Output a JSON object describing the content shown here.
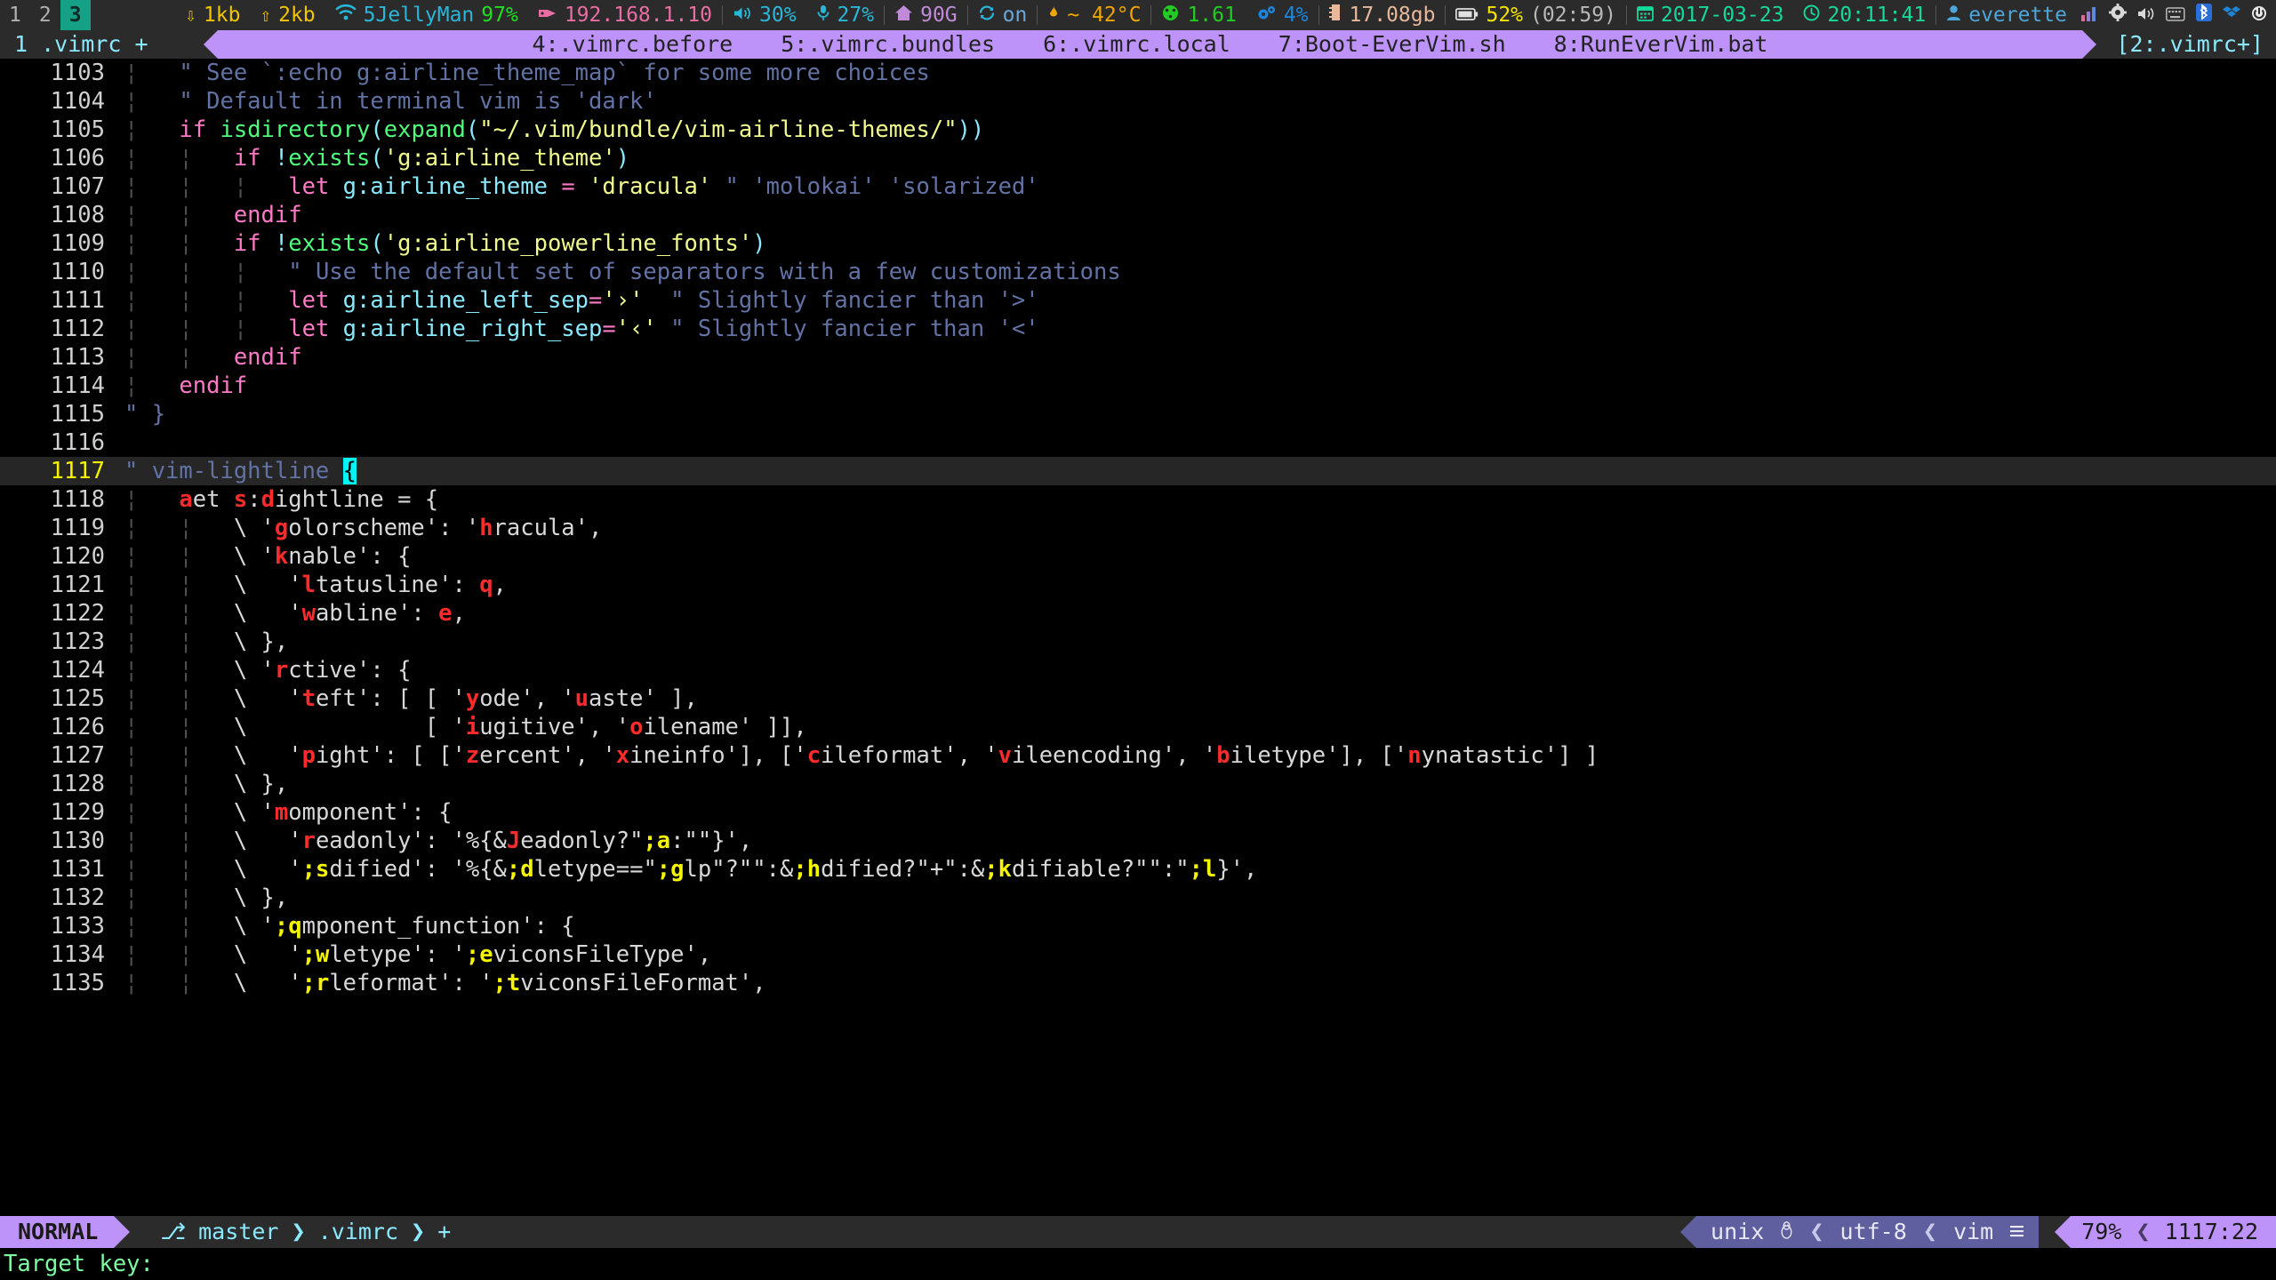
{
  "sysbar": {
    "workspaces": [
      {
        "label": "1",
        "active": false
      },
      {
        "label": "2",
        "active": false
      },
      {
        "label": "3",
        "active": true
      }
    ],
    "net_down_icon": "»",
    "net_down": "1kb",
    "net_up_icon": "«",
    "net_up": "2kb",
    "wifi_icon": "wifi-icon",
    "wifi_ssid": "5JellyMan",
    "wifi_strength": "97%",
    "ip_icon": "tag-icon",
    "ip_address": "192.168.1.10",
    "volume_icon": "speaker-icon",
    "volume": "30%",
    "mic_icon": "microphone-icon",
    "mic": "27%",
    "home_icon": "home-icon",
    "home_free": "90G",
    "sync_icon": "sync-icon",
    "sync_state": "on",
    "temp_icon": "flame-icon",
    "temp": "~ 42°C",
    "load_icon": "gauge-icon",
    "load": "1.61",
    "cpu_icon": "cogs-icon",
    "cpu": "4%",
    "ram_icon": "memory-icon",
    "ram": "17.08gb",
    "battery_icon": "battery-icon",
    "battery": "52%",
    "battery_time": "(02:59)",
    "date_icon": "calendar-icon",
    "date": "2017-03-23",
    "clock_icon": "clock-icon",
    "time": "20:11:41",
    "user_icon": "user-icon",
    "user": "everette",
    "tray": [
      "signal-bars-icon",
      "gear-icon",
      "volume-icon",
      "keyboard-icon",
      "bluetooth-icon",
      "dropbox-icon",
      "power-icon"
    ]
  },
  "tabline": {
    "current": "1 .vimrc +",
    "tabs": [
      "4:.vimrc.before",
      "5:.vimrc.bundles",
      "6:.vimrc.local",
      "7:Boot-EverVim.sh",
      "8:RunEverVim.bat"
    ],
    "buffer_indicator": "[2:.vimrc+]"
  },
  "buffer": {
    "lines": [
      {
        "num": "1103",
        "cursorline": false,
        "parts": [
          {
            "t": "¦   ",
            "c": "c-ind"
          },
          {
            "t": "\" See `:echo g:airline_theme_map` for some more choices",
            "c": "c-com"
          }
        ]
      },
      {
        "num": "1104",
        "cursorline": false,
        "parts": [
          {
            "t": "¦   ",
            "c": "c-ind"
          },
          {
            "t": "\" Default in terminal vim is 'dark'",
            "c": "c-com"
          }
        ]
      },
      {
        "num": "1105",
        "cursorline": false,
        "parts": [
          {
            "t": "¦   ",
            "c": "c-ind"
          },
          {
            "t": "if ",
            "c": "c-key"
          },
          {
            "t": "isdirectory",
            "c": "c-fn"
          },
          {
            "t": "(",
            "c": "c-punc"
          },
          {
            "t": "expand",
            "c": "c-fn"
          },
          {
            "t": "(",
            "c": "c-punc"
          },
          {
            "t": "\"~/.vim/bundle/vim-airline-themes/\"",
            "c": "c-str"
          },
          {
            "t": "))",
            "c": "c-punc"
          }
        ]
      },
      {
        "num": "1106",
        "cursorline": false,
        "parts": [
          {
            "t": "¦   ¦   ",
            "c": "c-ind"
          },
          {
            "t": "if ",
            "c": "c-key"
          },
          {
            "t": "!",
            "c": "c-punc"
          },
          {
            "t": "exists",
            "c": "c-fn"
          },
          {
            "t": "(",
            "c": "c-punc"
          },
          {
            "t": "'g:airline_theme'",
            "c": "c-str"
          },
          {
            "t": ")",
            "c": "c-punc"
          }
        ]
      },
      {
        "num": "1107",
        "cursorline": false,
        "parts": [
          {
            "t": "¦   ¦   ¦   ",
            "c": "c-ind"
          },
          {
            "t": "let ",
            "c": "c-key"
          },
          {
            "t": "g:airline_theme",
            "c": "c-id"
          },
          {
            "t": " ",
            "c": "c-pln"
          },
          {
            "t": "=",
            "c": "c-key"
          },
          {
            "t": " ",
            "c": "c-pln"
          },
          {
            "t": "'dracula'",
            "c": "c-str"
          },
          {
            "t": " \" 'molokai' 'solarized'",
            "c": "c-com"
          }
        ]
      },
      {
        "num": "1108",
        "cursorline": false,
        "parts": [
          {
            "t": "¦   ¦   ",
            "c": "c-ind"
          },
          {
            "t": "endif",
            "c": "c-key"
          }
        ]
      },
      {
        "num": "1109",
        "cursorline": false,
        "parts": [
          {
            "t": "¦   ¦   ",
            "c": "c-ind"
          },
          {
            "t": "if ",
            "c": "c-key"
          },
          {
            "t": "!",
            "c": "c-punc"
          },
          {
            "t": "exists",
            "c": "c-fn"
          },
          {
            "t": "(",
            "c": "c-punc"
          },
          {
            "t": "'g:airline_powerline_fonts'",
            "c": "c-str"
          },
          {
            "t": ")",
            "c": "c-punc"
          }
        ]
      },
      {
        "num": "1110",
        "cursorline": false,
        "parts": [
          {
            "t": "¦   ¦   ¦   ",
            "c": "c-ind"
          },
          {
            "t": "\" Use the default set of separators with a few customizations",
            "c": "c-com"
          }
        ]
      },
      {
        "num": "1111",
        "cursorline": false,
        "parts": [
          {
            "t": "¦   ¦   ¦   ",
            "c": "c-ind"
          },
          {
            "t": "let ",
            "c": "c-key"
          },
          {
            "t": "g:airline_left_sep",
            "c": "c-id"
          },
          {
            "t": "=",
            "c": "c-key"
          },
          {
            "t": "'›'",
            "c": "c-str"
          },
          {
            "t": "  \" Slightly fancier than '>'",
            "c": "c-com"
          }
        ]
      },
      {
        "num": "1112",
        "cursorline": false,
        "parts": [
          {
            "t": "¦   ¦   ¦   ",
            "c": "c-ind"
          },
          {
            "t": "let ",
            "c": "c-key"
          },
          {
            "t": "g:airline_right_sep",
            "c": "c-id"
          },
          {
            "t": "=",
            "c": "c-key"
          },
          {
            "t": "'‹'",
            "c": "c-str"
          },
          {
            "t": " \" Slightly fancier than '<'",
            "c": "c-com"
          }
        ]
      },
      {
        "num": "1113",
        "cursorline": false,
        "parts": [
          {
            "t": "¦   ¦   ",
            "c": "c-ind"
          },
          {
            "t": "endif",
            "c": "c-key"
          }
        ]
      },
      {
        "num": "1114",
        "cursorline": false,
        "parts": [
          {
            "t": "¦   ",
            "c": "c-ind"
          },
          {
            "t": "endif",
            "c": "c-key"
          }
        ]
      },
      {
        "num": "1115",
        "cursorline": false,
        "parts": [
          {
            "t": "\" }",
            "c": "c-com"
          }
        ]
      },
      {
        "num": "1116",
        "cursorline": false,
        "parts": []
      },
      {
        "num": "1117",
        "cursorline": true,
        "parts": [
          {
            "t": "\" vim-lightline ",
            "c": "c-com"
          },
          {
            "t": "{",
            "c": "cursor"
          }
        ]
      },
      {
        "num": "1118",
        "cursorline": false,
        "parts": [
          {
            "t": "¦   ",
            "c": "c-ind"
          },
          {
            "t": "a",
            "c": "c-em"
          },
          {
            "t": "et ",
            "c": "c-pln"
          },
          {
            "t": "s",
            "c": "c-em"
          },
          {
            "t": ":",
            "c": "c-pln"
          },
          {
            "t": "d",
            "c": "c-em"
          },
          {
            "t": "ightline = {",
            "c": "c-pln"
          }
        ]
      },
      {
        "num": "1119",
        "cursorline": false,
        "parts": [
          {
            "t": "¦   ¦   ",
            "c": "c-ind"
          },
          {
            "t": "\\ '",
            "c": "c-pln"
          },
          {
            "t": "g",
            "c": "c-em"
          },
          {
            "t": "olorscheme': '",
            "c": "c-pln"
          },
          {
            "t": "h",
            "c": "c-em"
          },
          {
            "t": "racula',",
            "c": "c-pln"
          }
        ]
      },
      {
        "num": "1120",
        "cursorline": false,
        "parts": [
          {
            "t": "¦   ¦   ",
            "c": "c-ind"
          },
          {
            "t": "\\ '",
            "c": "c-pln"
          },
          {
            "t": "k",
            "c": "c-em"
          },
          {
            "t": "nable': {",
            "c": "c-pln"
          }
        ]
      },
      {
        "num": "1121",
        "cursorline": false,
        "parts": [
          {
            "t": "¦   ¦   ",
            "c": "c-ind"
          },
          {
            "t": "\\   '",
            "c": "c-pln"
          },
          {
            "t": "l",
            "c": "c-em"
          },
          {
            "t": "tatusline': ",
            "c": "c-pln"
          },
          {
            "t": "q",
            "c": "c-em"
          },
          {
            "t": ",",
            "c": "c-pln"
          }
        ]
      },
      {
        "num": "1122",
        "cursorline": false,
        "parts": [
          {
            "t": "¦   ¦   ",
            "c": "c-ind"
          },
          {
            "t": "\\   '",
            "c": "c-pln"
          },
          {
            "t": "w",
            "c": "c-em"
          },
          {
            "t": "abline': ",
            "c": "c-pln"
          },
          {
            "t": "e",
            "c": "c-em"
          },
          {
            "t": ",",
            "c": "c-pln"
          }
        ]
      },
      {
        "num": "1123",
        "cursorline": false,
        "parts": [
          {
            "t": "¦   ¦   ",
            "c": "c-ind"
          },
          {
            "t": "\\ },",
            "c": "c-pln"
          }
        ]
      },
      {
        "num": "1124",
        "cursorline": false,
        "parts": [
          {
            "t": "¦   ¦   ",
            "c": "c-ind"
          },
          {
            "t": "\\ '",
            "c": "c-pln"
          },
          {
            "t": "r",
            "c": "c-em"
          },
          {
            "t": "ctive': {",
            "c": "c-pln"
          }
        ]
      },
      {
        "num": "1125",
        "cursorline": false,
        "parts": [
          {
            "t": "¦   ¦   ",
            "c": "c-ind"
          },
          {
            "t": "\\   '",
            "c": "c-pln"
          },
          {
            "t": "t",
            "c": "c-em"
          },
          {
            "t": "eft': [ [ '",
            "c": "c-pln"
          },
          {
            "t": "y",
            "c": "c-em"
          },
          {
            "t": "ode', '",
            "c": "c-pln"
          },
          {
            "t": "u",
            "c": "c-em"
          },
          {
            "t": "aste' ],",
            "c": "c-pln"
          }
        ]
      },
      {
        "num": "1126",
        "cursorline": false,
        "parts": [
          {
            "t": "¦   ¦   ",
            "c": "c-ind"
          },
          {
            "t": "\\             [ '",
            "c": "c-pln"
          },
          {
            "t": "i",
            "c": "c-em"
          },
          {
            "t": "ugitive', '",
            "c": "c-pln"
          },
          {
            "t": "o",
            "c": "c-em"
          },
          {
            "t": "ilename' ]],",
            "c": "c-pln"
          }
        ]
      },
      {
        "num": "1127",
        "cursorline": false,
        "parts": [
          {
            "t": "¦   ¦   ",
            "c": "c-ind"
          },
          {
            "t": "\\   '",
            "c": "c-pln"
          },
          {
            "t": "p",
            "c": "c-em"
          },
          {
            "t": "ight': [ ['",
            "c": "c-pln"
          },
          {
            "t": "z",
            "c": "c-em"
          },
          {
            "t": "ercent', '",
            "c": "c-pln"
          },
          {
            "t": "x",
            "c": "c-em"
          },
          {
            "t": "ineinfo'], ['",
            "c": "c-pln"
          },
          {
            "t": "c",
            "c": "c-em"
          },
          {
            "t": "ileformat', '",
            "c": "c-pln"
          },
          {
            "t": "v",
            "c": "c-em"
          },
          {
            "t": "ileencoding', '",
            "c": "c-pln"
          },
          {
            "t": "b",
            "c": "c-em"
          },
          {
            "t": "iletype'], ['",
            "c": "c-pln"
          },
          {
            "t": "n",
            "c": "c-em"
          },
          {
            "t": "ynatastic'] ]",
            "c": "c-pln"
          }
        ]
      },
      {
        "num": "1128",
        "cursorline": false,
        "parts": [
          {
            "t": "¦   ¦   ",
            "c": "c-ind"
          },
          {
            "t": "\\ },",
            "c": "c-pln"
          }
        ]
      },
      {
        "num": "1129",
        "cursorline": false,
        "parts": [
          {
            "t": "¦   ¦   ",
            "c": "c-ind"
          },
          {
            "t": "\\ '",
            "c": "c-pln"
          },
          {
            "t": "m",
            "c": "c-em"
          },
          {
            "t": "omponent': {",
            "c": "c-pln"
          }
        ]
      },
      {
        "num": "1130",
        "cursorline": false,
        "parts": [
          {
            "t": "¦   ¦   ",
            "c": "c-ind"
          },
          {
            "t": "\\   '",
            "c": "c-pln"
          },
          {
            "t": "r",
            "c": "c-em"
          },
          {
            "t": "eadonly': '%{&",
            "c": "c-pln"
          },
          {
            "t": "J",
            "c": "c-em"
          },
          {
            "t": "eadonly?\"",
            "c": "c-pln"
          },
          {
            "t": ";a",
            "c": "c-em2"
          },
          {
            "t": ":\"\"}',",
            "c": "c-pln"
          }
        ]
      },
      {
        "num": "1131",
        "cursorline": false,
        "parts": [
          {
            "t": "¦   ¦   ",
            "c": "c-ind"
          },
          {
            "t": "\\   '",
            "c": "c-pln"
          },
          {
            "t": ";s",
            "c": "c-em2"
          },
          {
            "t": "dified': '%{&",
            "c": "c-pln"
          },
          {
            "t": ";d",
            "c": "c-em2"
          },
          {
            "t": "letype==\"",
            "c": "c-pln"
          },
          {
            "t": ";g",
            "c": "c-em2"
          },
          {
            "t": "lp\"?\"\":&",
            "c": "c-pln"
          },
          {
            "t": ";h",
            "c": "c-em2"
          },
          {
            "t": "dified?\"+\":&",
            "c": "c-pln"
          },
          {
            "t": ";k",
            "c": "c-em2"
          },
          {
            "t": "difiable?\"\":\"",
            "c": "c-pln"
          },
          {
            "t": ";l",
            "c": "c-em2"
          },
          {
            "t": "}',",
            "c": "c-pln"
          }
        ]
      },
      {
        "num": "1132",
        "cursorline": false,
        "parts": [
          {
            "t": "¦   ¦   ",
            "c": "c-ind"
          },
          {
            "t": "\\ },",
            "c": "c-pln"
          }
        ]
      },
      {
        "num": "1133",
        "cursorline": false,
        "parts": [
          {
            "t": "¦   ¦   ",
            "c": "c-ind"
          },
          {
            "t": "\\ '",
            "c": "c-pln"
          },
          {
            "t": ";q",
            "c": "c-em2"
          },
          {
            "t": "mponent_function': {",
            "c": "c-pln"
          }
        ]
      },
      {
        "num": "1134",
        "cursorline": false,
        "parts": [
          {
            "t": "¦   ¦   ",
            "c": "c-ind"
          },
          {
            "t": "\\   '",
            "c": "c-pln"
          },
          {
            "t": ";w",
            "c": "c-em2"
          },
          {
            "t": "letype': '",
            "c": "c-pln"
          },
          {
            "t": ";e",
            "c": "c-em2"
          },
          {
            "t": "viconsFileType',",
            "c": "c-pln"
          }
        ]
      },
      {
        "num": "1135",
        "cursorline": false,
        "parts": [
          {
            "t": "¦   ¦   ",
            "c": "c-ind"
          },
          {
            "t": "\\   '",
            "c": "c-pln"
          },
          {
            "t": ";r",
            "c": "c-em2"
          },
          {
            "t": "leformat': '",
            "c": "c-pln"
          },
          {
            "t": ";t",
            "c": "c-em2"
          },
          {
            "t": "viconsFileFormat',",
            "c": "c-pln"
          }
        ]
      }
    ]
  },
  "statusline": {
    "mode": "NORMAL",
    "branch_icon": "git-branch-icon",
    "branch": "master",
    "file": ".vimrc",
    "modified": "+",
    "chevron": "❯",
    "chevron_left": "❮",
    "fileformat": "unix",
    "os_icon": "linux-penguin-icon",
    "encoding": "utf-8",
    "filetype": "vim",
    "filetype_icon": "vim-icon",
    "percent": "79%",
    "position": "1117:22"
  },
  "cmdline": {
    "text": "Target key:"
  }
}
